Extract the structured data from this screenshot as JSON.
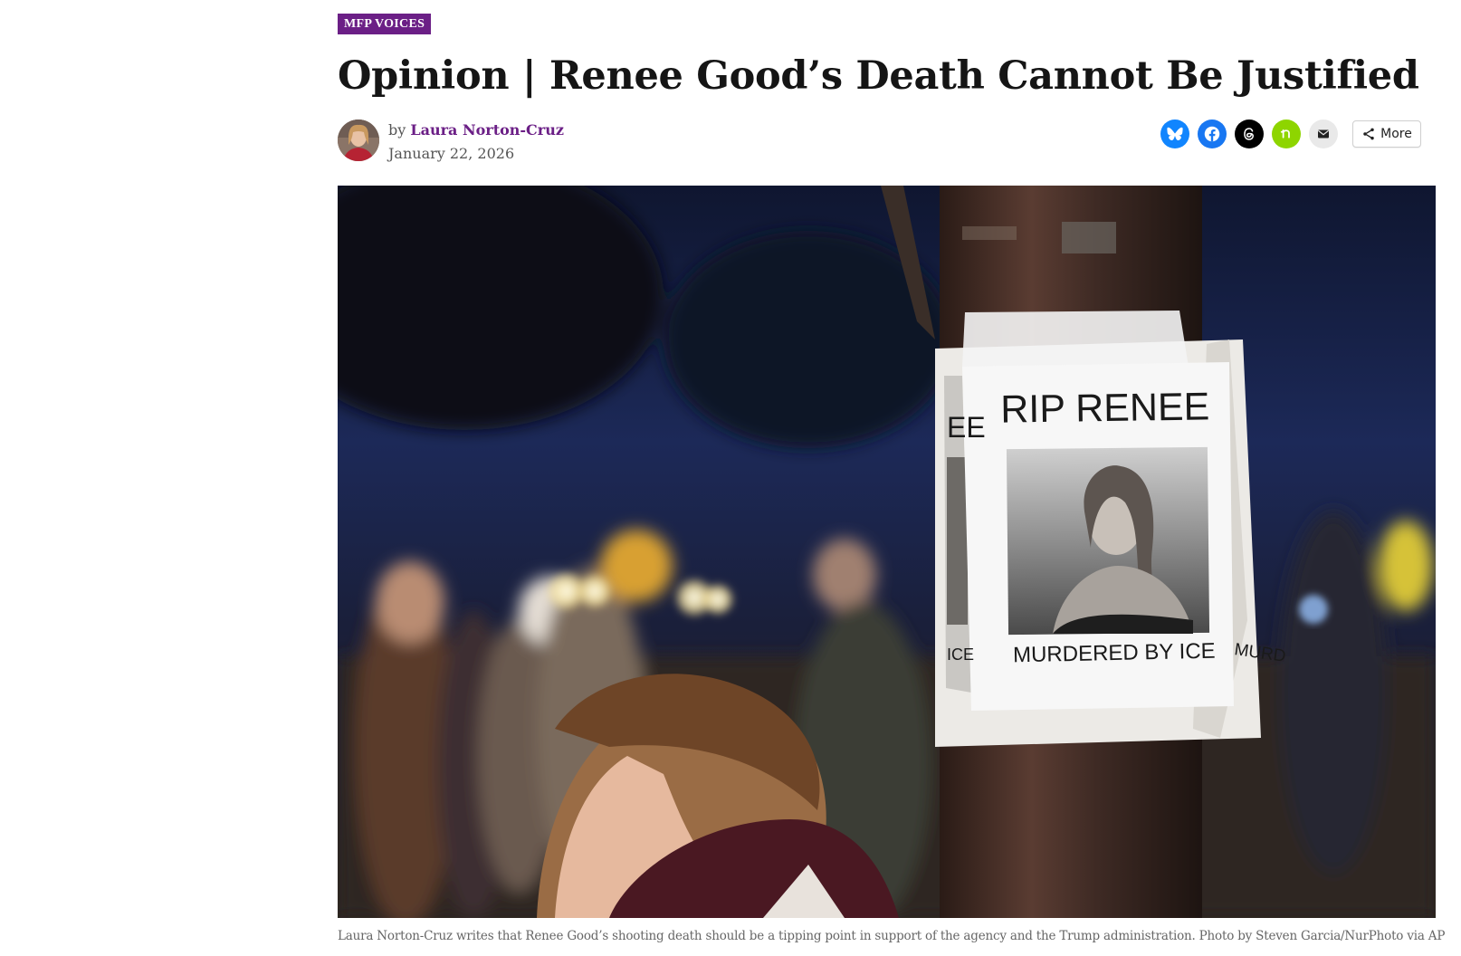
{
  "article": {
    "category": "MFP VOICES",
    "title": "Opinion | Renee Good’s Death Cannot Be Justified",
    "byline_prefix": "by",
    "author": "Laura Norton-Cruz",
    "date": "January 22, 2026"
  },
  "share": {
    "buttons": [
      {
        "name": "bluesky",
        "icon": "bluesky-icon",
        "color": "#1185fe"
      },
      {
        "name": "facebook",
        "icon": "facebook-icon",
        "color": "#1877f2"
      },
      {
        "name": "threads",
        "icon": "threads-icon",
        "color": "#000000"
      },
      {
        "name": "nextdoor",
        "icon": "nextdoor-icon",
        "color": "#8ed500"
      },
      {
        "name": "email",
        "icon": "email-icon",
        "color": "#e9e9e9"
      }
    ],
    "more_label": "More",
    "more_icon": "share-icon"
  },
  "photo": {
    "poster_heading": "RIP RENEE",
    "poster_footer": "MURDERED BY ICE",
    "poster_left_fragment_top": "EE",
    "poster_left_fragment_bottom": "ICE",
    "poster_right_fragment": "MURD"
  },
  "caption": "Laura Norton-Cruz writes that Renee Good’s shooting death should be a tipping point in support of the agency and the Trump administration. Photo by Steven Garcia/NurPhoto via AP",
  "colors": {
    "brand_purple": "#6b1f86"
  }
}
